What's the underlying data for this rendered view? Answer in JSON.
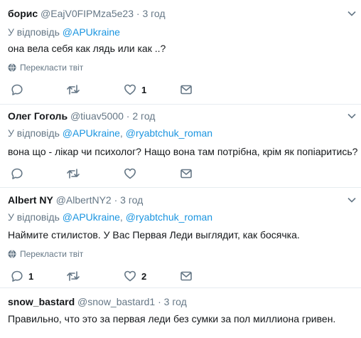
{
  "reply_prefix": "У відповідь",
  "translate_label": "Перекласти твіт",
  "tweets": [
    {
      "name": "борис",
      "handle": "@EajV0FIPMza5e23",
      "sep": "·",
      "time": "3 год",
      "reply_to": "@APUkraine",
      "reply_sep": "",
      "reply_to_2": "",
      "text": "она вела себя как лядь или как ..?",
      "replies": "",
      "retweets": "",
      "likes": "1",
      "avatar_color": "#a8cf52"
    },
    {
      "name": "Олег Гоголь",
      "handle": "@tiuav5000",
      "sep": "·",
      "time": "2 год",
      "reply_to": "@APUkraine",
      "reply_sep": ",",
      "reply_to_2": "@ryabtchuk_roman",
      "text": "вона що - лікар чи психолог? Нащо вона там потрібна, крім як попіаритись?",
      "replies": "",
      "retweets": "",
      "likes": "",
      "avatar_color": "#8b5a3c"
    },
    {
      "name": "Albert NY",
      "handle": "@AlbertNY2",
      "sep": "·",
      "time": "3 год",
      "reply_to": "@APUkraine",
      "reply_sep": ",",
      "reply_to_2": "@ryabtchuk_roman",
      "text": "Наймите стилистов. У Вас Первая Леди выглядит, как босячка.",
      "replies": "1",
      "retweets": "",
      "likes": "2",
      "avatar_color": "#5b7fa3"
    },
    {
      "name": "snow_bastard",
      "handle": "@snow_bastard1",
      "sep": "·",
      "time": "3 год",
      "reply_to": "",
      "reply_sep": "",
      "reply_to_2": "",
      "text": "Правильно, что это за первая леди без сумки за пол миллиона гривен.",
      "replies": "",
      "retweets": "",
      "likes": "",
      "avatar_color": "#7a7a7a"
    }
  ]
}
